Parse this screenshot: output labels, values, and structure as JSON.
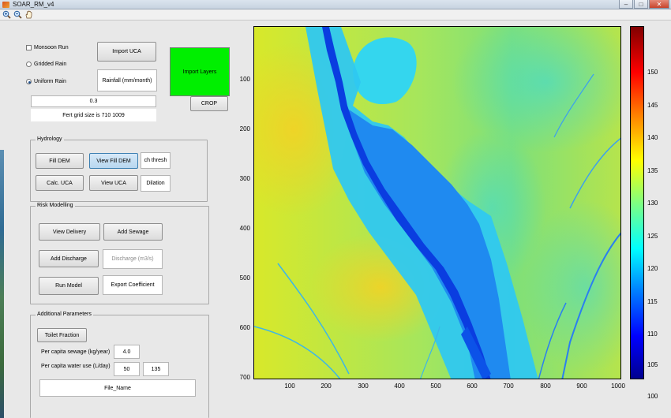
{
  "window": {
    "title": "SOAR_RM_v4",
    "minimize": "–",
    "maximize": "□",
    "close": "✕"
  },
  "toolbar": {
    "tools": [
      "zoom-in-icon",
      "zoom-out-icon",
      "pan-hand-icon"
    ]
  },
  "inputs": {
    "monsoon_run": "Monsoon Run",
    "gridded_rain": "Gridded Rain",
    "uniform_rain": "Uniform Rain",
    "uniform_rain_selected": true,
    "import_uca": "Import UCA",
    "import_layers": "Import Layers",
    "rainfall_field": "Rainfall (mm/month)",
    "value_field": "0.3",
    "grid_size_text": "Fert grid size is 710  1009",
    "crop": "CROP"
  },
  "hydrology": {
    "title": "Hydrology",
    "fill_dem": "Fill DEM",
    "view_fill_dem": "View Fill DEM",
    "ch_thresh": "ch thresh",
    "calc_uca": "Calc. UCA",
    "view_uca": "View UCA",
    "dilation": "Dilation"
  },
  "risk": {
    "title": "Risk Modelling",
    "view_delivery": "View Delivery",
    "add_sewage": "Add Sewage",
    "add_discharge": "Add Discharge",
    "discharge_field": "Discharge (m3/s)",
    "run_model": "Run Model",
    "export_coefficient": "Export Coefficient"
  },
  "additional": {
    "title": "Additional Parameters",
    "toilet_fraction": "Toilet Fraction",
    "sewage_label": "Per capita sewage (kg/year)",
    "sewage_value": "4.0",
    "water_label": "Per capita water use (L/day)",
    "water_value_1": "50",
    "water_value_2": "135",
    "file_name": "File_Name"
  },
  "plot": {
    "y_ticks": [
      "100",
      "200",
      "300",
      "400",
      "500",
      "600",
      "700"
    ],
    "x_ticks": [
      "100",
      "200",
      "300",
      "400",
      "500",
      "600",
      "700",
      "800",
      "900",
      "1000"
    ],
    "colorbar_ticks": [
      "150",
      "145",
      "140",
      "135",
      "130",
      "125",
      "120",
      "115",
      "110",
      "105",
      "100"
    ],
    "colormap": "jet",
    "value_range": [
      98,
      155
    ],
    "y_range": [
      1,
      710
    ],
    "x_range": [
      1,
      1009
    ]
  }
}
